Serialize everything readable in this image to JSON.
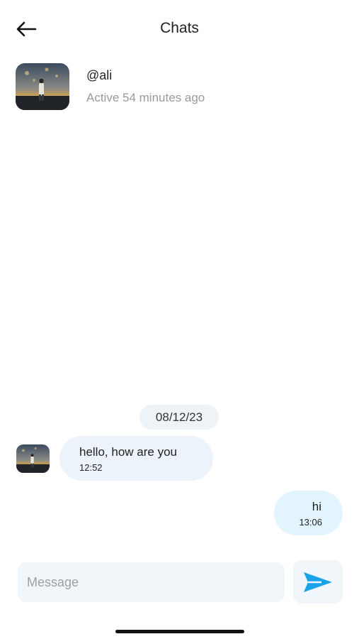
{
  "header": {
    "title": "Chats",
    "back_icon": "arrow-left-icon"
  },
  "contact": {
    "username": "@ali",
    "status": "Active 54 minutes ago"
  },
  "messages": {
    "date": "08/12/23",
    "items": [
      {
        "direction": "incoming",
        "text": "hello, how are you",
        "time": "12:52"
      },
      {
        "direction": "outgoing",
        "text": "hi",
        "time": "13:06"
      }
    ]
  },
  "composer": {
    "placeholder": "Message",
    "value": "",
    "send_icon": "send-icon"
  },
  "colors": {
    "accent": "#1aa3e8",
    "incoming_bubble": "#edf3fa",
    "outgoing_bubble": "#e2f4fd",
    "input_bg": "#f1f6fb",
    "muted_text": "#9a9a9a"
  }
}
